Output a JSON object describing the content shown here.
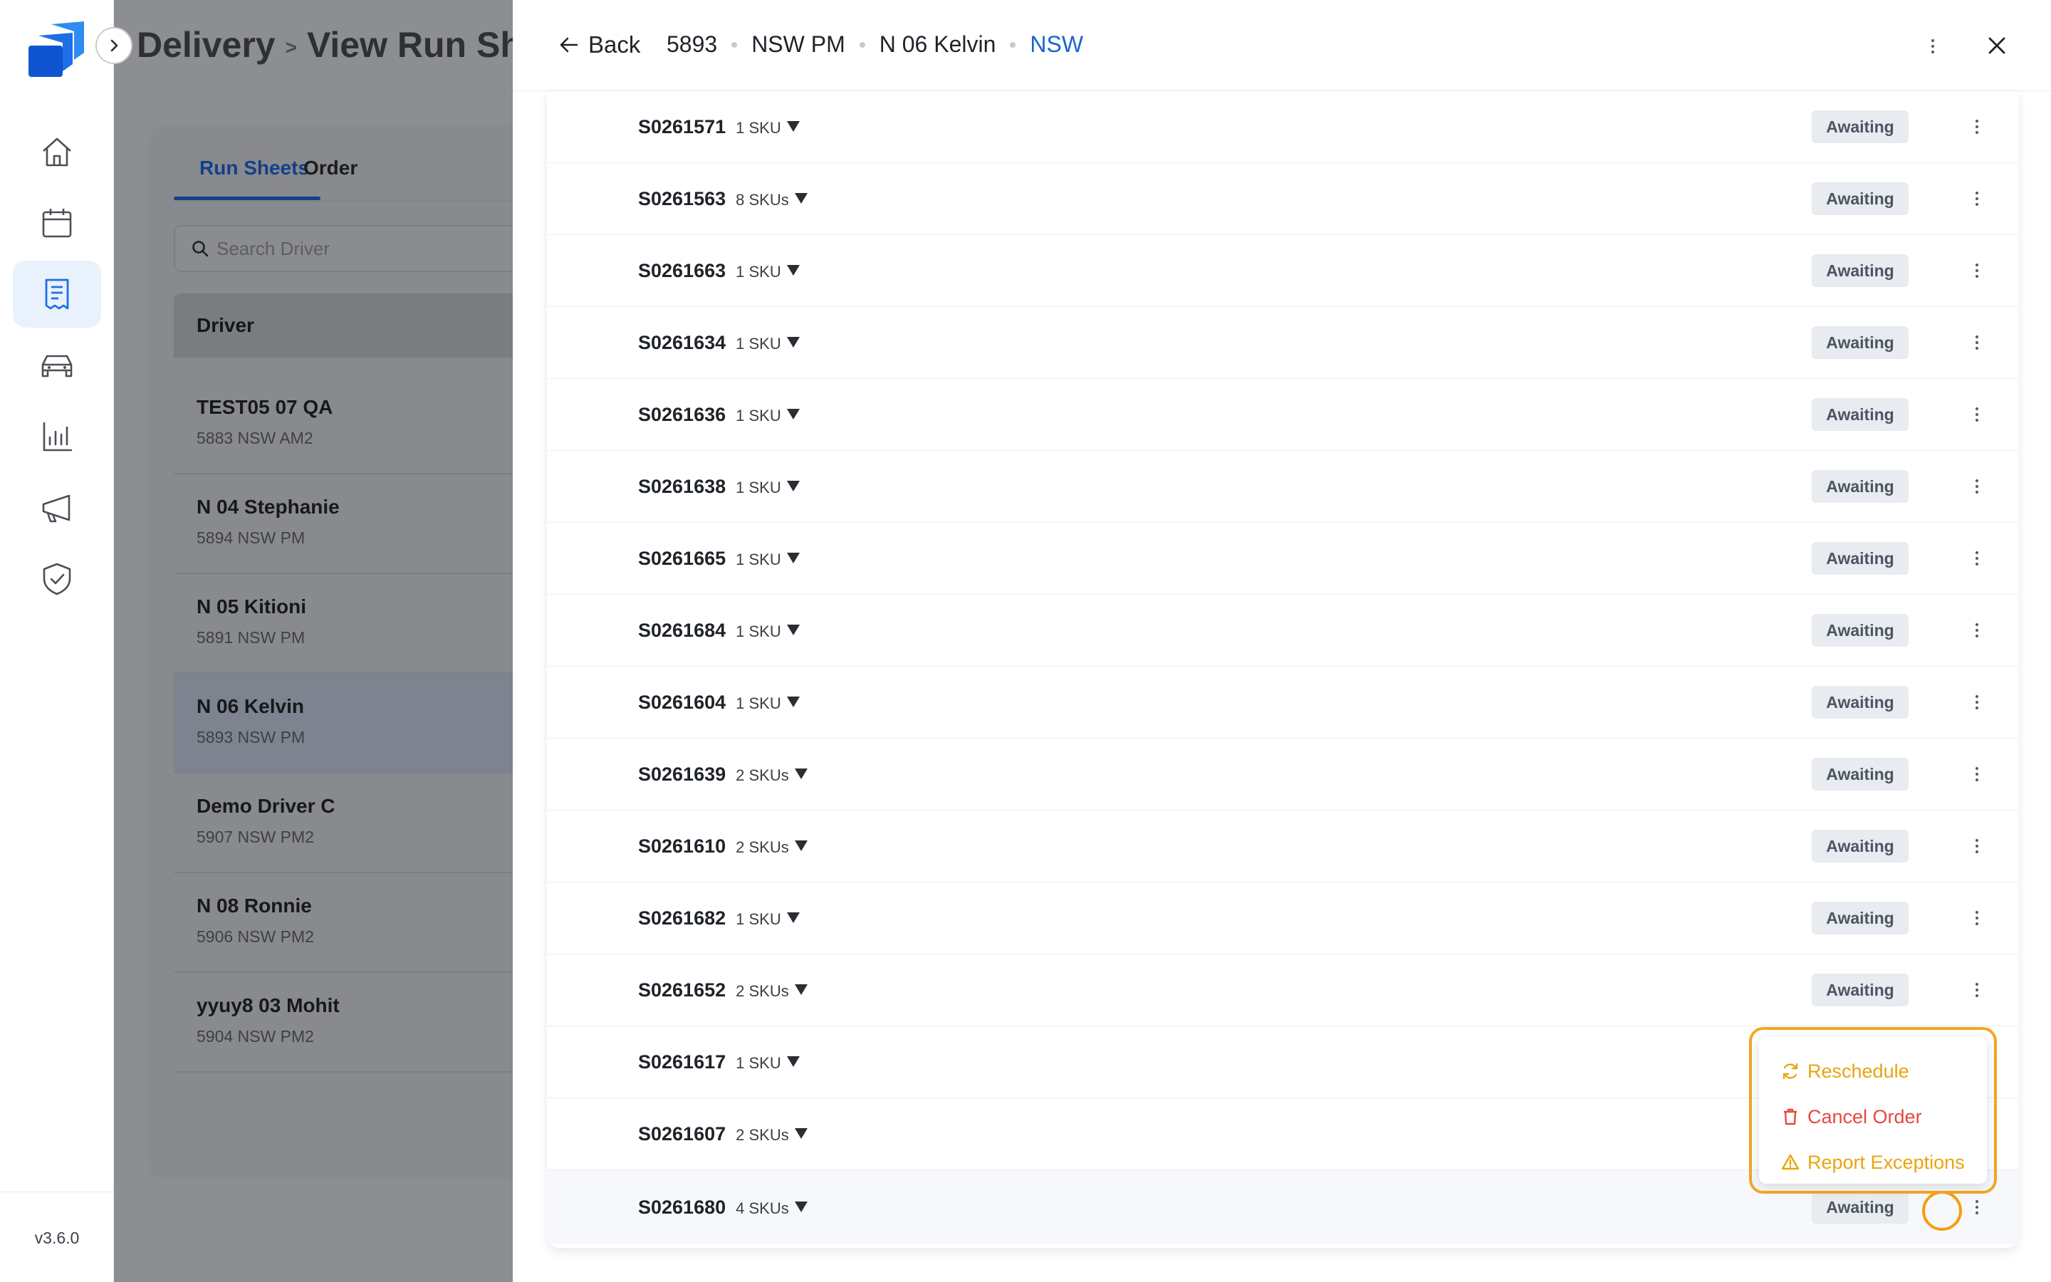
{
  "app": {
    "version": "v3.6.0",
    "colors": {
      "accent": "#1a66cc",
      "brand_blue": "#1f6fe5",
      "awaiting_bg": "#e8ebef",
      "highlight": "#f5a623",
      "danger": "#e5483d",
      "warning": "#e9a411"
    }
  },
  "sidebar": {
    "items": [
      {
        "icon": "home-icon",
        "active": false
      },
      {
        "icon": "calendar-icon",
        "active": false
      },
      {
        "icon": "run-sheet-icon",
        "active": true
      },
      {
        "icon": "car-icon",
        "active": false
      },
      {
        "icon": "chart-icon",
        "active": false
      },
      {
        "icon": "megaphone-icon",
        "active": false
      },
      {
        "icon": "shield-check-icon",
        "active": false
      }
    ]
  },
  "background_page": {
    "breadcrumb": [
      "Delivery",
      "View Run She"
    ],
    "tabs": [
      "Run Sheets",
      "Order"
    ],
    "search_placeholder": "Search Driver",
    "table_header": "Driver",
    "drivers": [
      {
        "name": "TEST05 07 QA",
        "sub": "5883 NSW AM2"
      },
      {
        "name": "N 04 Stephanie",
        "sub": "5894 NSW PM"
      },
      {
        "name": "N 05 Kitioni",
        "sub": "5891 NSW PM"
      },
      {
        "name": "N 06 Kelvin",
        "sub": "5893 NSW PM",
        "selected": true
      },
      {
        "name": "Demo Driver C",
        "sub": "5907 NSW PM2"
      },
      {
        "name": "N 08 Ronnie",
        "sub": "5906 NSW PM2"
      },
      {
        "name": "yyuy8 03 Mohit",
        "sub": "5904 NSW PM2"
      }
    ]
  },
  "drawer": {
    "back_label": "Back",
    "crumbs": [
      "5893",
      "NSW PM",
      "N 06 Kelvin",
      "NSW"
    ],
    "orders": [
      {
        "id": "S0261571",
        "sku": "1 SKU",
        "status": "Awaiting"
      },
      {
        "id": "S0261563",
        "sku": "8 SKUs",
        "status": "Awaiting"
      },
      {
        "id": "S0261663",
        "sku": "1 SKU",
        "status": "Awaiting"
      },
      {
        "id": "S0261634",
        "sku": "1 SKU",
        "status": "Awaiting"
      },
      {
        "id": "S0261636",
        "sku": "1 SKU",
        "status": "Awaiting"
      },
      {
        "id": "S0261638",
        "sku": "1 SKU",
        "status": "Awaiting"
      },
      {
        "id": "S0261665",
        "sku": "1 SKU",
        "status": "Awaiting"
      },
      {
        "id": "S0261684",
        "sku": "1 SKU",
        "status": "Awaiting"
      },
      {
        "id": "S0261604",
        "sku": "1 SKU",
        "status": "Awaiting"
      },
      {
        "id": "S0261639",
        "sku": "2 SKUs",
        "status": "Awaiting"
      },
      {
        "id": "S0261610",
        "sku": "2 SKUs",
        "status": "Awaiting"
      },
      {
        "id": "S0261682",
        "sku": "1 SKU",
        "status": "Awaiting"
      },
      {
        "id": "S0261652",
        "sku": "2 SKUs",
        "status": "Awaiting"
      },
      {
        "id": "S0261617",
        "sku": "1 SKU",
        "status": ""
      },
      {
        "id": "S0261607",
        "sku": "2 SKUs",
        "status": ""
      },
      {
        "id": "S0261680",
        "sku": "4 SKUs",
        "status": "Awaiting"
      }
    ],
    "menu": {
      "reschedule": "Reschedule",
      "cancel": "Cancel Order",
      "report": "Report Exceptions"
    }
  }
}
